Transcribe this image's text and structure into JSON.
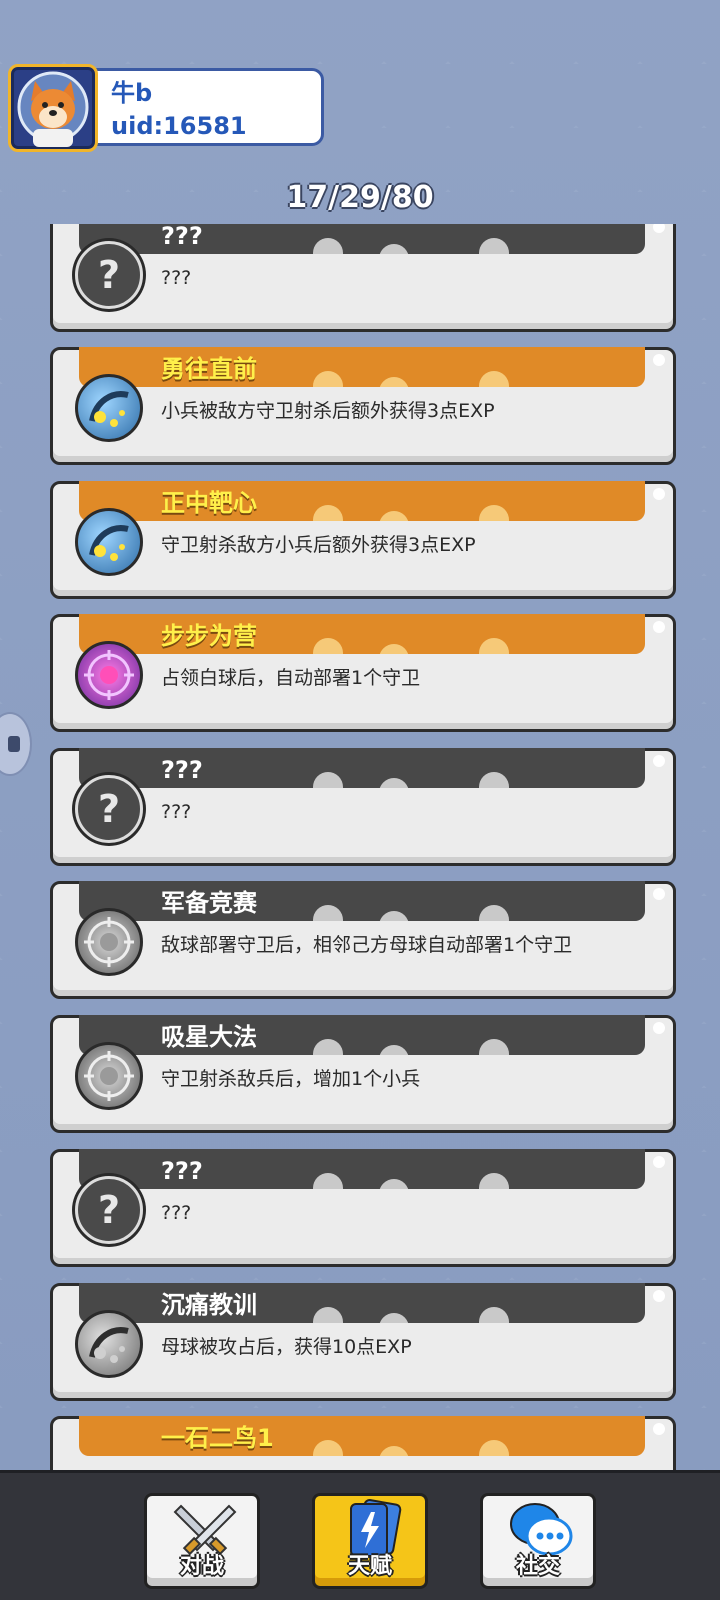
{
  "profile": {
    "name": "牛b",
    "uid": "uid:16581"
  },
  "counter": "17/29/80",
  "talents": [
    {
      "title": "???",
      "desc": "???",
      "style": "dark",
      "icon": "question-icon"
    },
    {
      "title": "勇往直前",
      "desc": "小兵被敌方守卫射杀后额外获得3点EXP",
      "style": "gold",
      "icon": "comet-orb-icon"
    },
    {
      "title": "正中靶心",
      "desc": "守卫射杀敌方小兵后额外获得3点EXP",
      "style": "gold",
      "icon": "comet-orb-icon"
    },
    {
      "title": "步步为营",
      "desc": "占领白球后，自动部署1个守卫",
      "style": "gold",
      "icon": "purple-crosshair-orb-icon"
    },
    {
      "title": "???",
      "desc": "???",
      "style": "dark",
      "icon": "question-icon"
    },
    {
      "title": "军备竞赛",
      "desc": "敌球部署守卫后，相邻己方母球自动部署1个守卫",
      "style": "dark",
      "icon": "gray-crosshair-orb-icon"
    },
    {
      "title": "吸星大法",
      "desc": "守卫射杀敌兵后，增加1个小兵",
      "style": "dark",
      "icon": "gray-crosshair-orb-icon"
    },
    {
      "title": "???",
      "desc": "???",
      "style": "dark",
      "icon": "question-icon"
    },
    {
      "title": "沉痛教训",
      "desc": "母球被攻占后，获得10点EXP",
      "style": "dark",
      "icon": "gray-comet-orb-icon"
    },
    {
      "title": "一石二鸟1",
      "desc": "",
      "style": "gold",
      "icon": "comet-orb-icon"
    }
  ],
  "nav": {
    "battle": "对战",
    "talent": "天赋",
    "social": "社交"
  }
}
